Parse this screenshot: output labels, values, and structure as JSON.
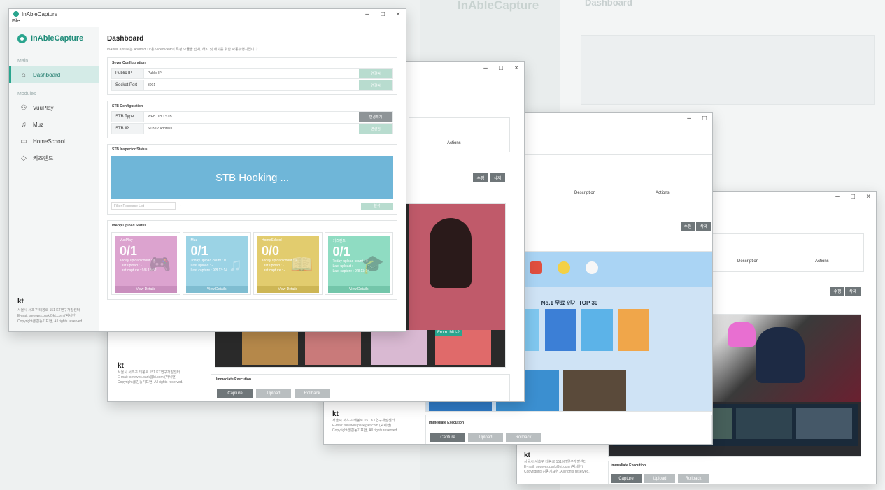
{
  "app": {
    "title": "InAbleCapture",
    "menu_file": "File",
    "brand": "InAbleCapture"
  },
  "sidebar": {
    "main_label": "Main",
    "modules_label": "Modules",
    "items": [
      {
        "label": "Dashboard",
        "icon": "home-icon"
      },
      {
        "label": "VuuPlay",
        "icon": "gamepad-icon"
      },
      {
        "label": "Muz",
        "icon": "music-icon"
      },
      {
        "label": "HomeSchool",
        "icon": "book-icon"
      },
      {
        "label": "키즈랜드",
        "icon": "graduation-cap-icon"
      }
    ],
    "footer": {
      "logo": "kt",
      "line1": "서울시 서초구 태봉로 151 KT연구개발센터",
      "line2": "E-mail: sewwes.park@kt.com (박세현)",
      "line3": "Copyright@김동기표현, All rights reserved."
    }
  },
  "dashboard": {
    "title": "Dashboard",
    "description": "InAbleCapture는 Android TV용 VideoView의 특정 모듈을 캡처, 해지 및 패치를 위한 자동수행지입니다",
    "server_config": {
      "title": "Sever Configuration",
      "public_ip_label": "Public IP",
      "public_ip_value": "Public IP",
      "socket_port_label": "Socket Port",
      "socket_port_value": "3001",
      "connect_button": "연결됨",
      "connect_button2": "연결됨"
    },
    "stb_config": {
      "title": "STB Configuration",
      "type_label": "STB Type",
      "type_value": "WEB UHD STB",
      "type_button": "변경해기",
      "ip_label": "STB IP",
      "ip_placeholder": "STB IP Address",
      "ip_button": "연결됨"
    },
    "inspector": {
      "title": "STB Inspector Status",
      "hooking_text": "STB Hooking ...",
      "filter_placeholder": "Filter Resource List",
      "arrow": "›",
      "action_button": "분석"
    },
    "upload_status": {
      "title": "InApp Upload Status",
      "cards": [
        {
          "name": "VuuPlay",
          "count": "0/1",
          "line1": "Today upload count : 0",
          "line2": "Last upload : -",
          "line3": "Last capture : 9/8 13:32",
          "footer": "View Details",
          "color": "#dca3cf",
          "footer_color": "#c98ebd",
          "icon": "gamepad-icon",
          "glyph": "🎮"
        },
        {
          "name": "Muz",
          "count": "0/1",
          "line1": "Today upload count : 0",
          "line2": "Last upload : -",
          "line3": "Last capture : 9/8 13:14",
          "footer": "View Details",
          "color": "#9bd3e5",
          "footer_color": "#7fbdd1",
          "icon": "music-icon",
          "glyph": "♫"
        },
        {
          "name": "HomeSchool",
          "count": "0/0",
          "line1": "Today upload count : 0",
          "line2": "Last upload : -",
          "line3": "Last capture : -",
          "footer": "View Details",
          "color": "#e2cc6e",
          "footer_color": "#cdb655",
          "icon": "book-icon",
          "glyph": "📖"
        },
        {
          "name": "키즈랜드",
          "count": "0/1",
          "line1": "Today upload count : 0",
          "line2": "Last upload : -",
          "line3": "Last capture : 9/8 13:14",
          "footer": "View Details",
          "color": "#8fdcc2",
          "footer_color": "#73c6aa",
          "icon": "graduation-cap-icon",
          "glyph": "🎓"
        }
      ]
    }
  },
  "back_windows": {
    "actions_label": "Actions",
    "description_label": "Description",
    "edit_button": "수정",
    "delete_button": "삭제",
    "immediate_label": "Immediate Execution",
    "capture_button": "Capture",
    "upload_button": "Upload",
    "rollback_button": "Rollback",
    "badge_from": "From. MU-2",
    "top30_title": "No.1 무료 인기 TOP 30"
  },
  "colors": {
    "accent": "#2aa58e",
    "hooking": "#6fb6d8",
    "button_dark": "#6f7679",
    "button_light": "#b9bec0"
  }
}
